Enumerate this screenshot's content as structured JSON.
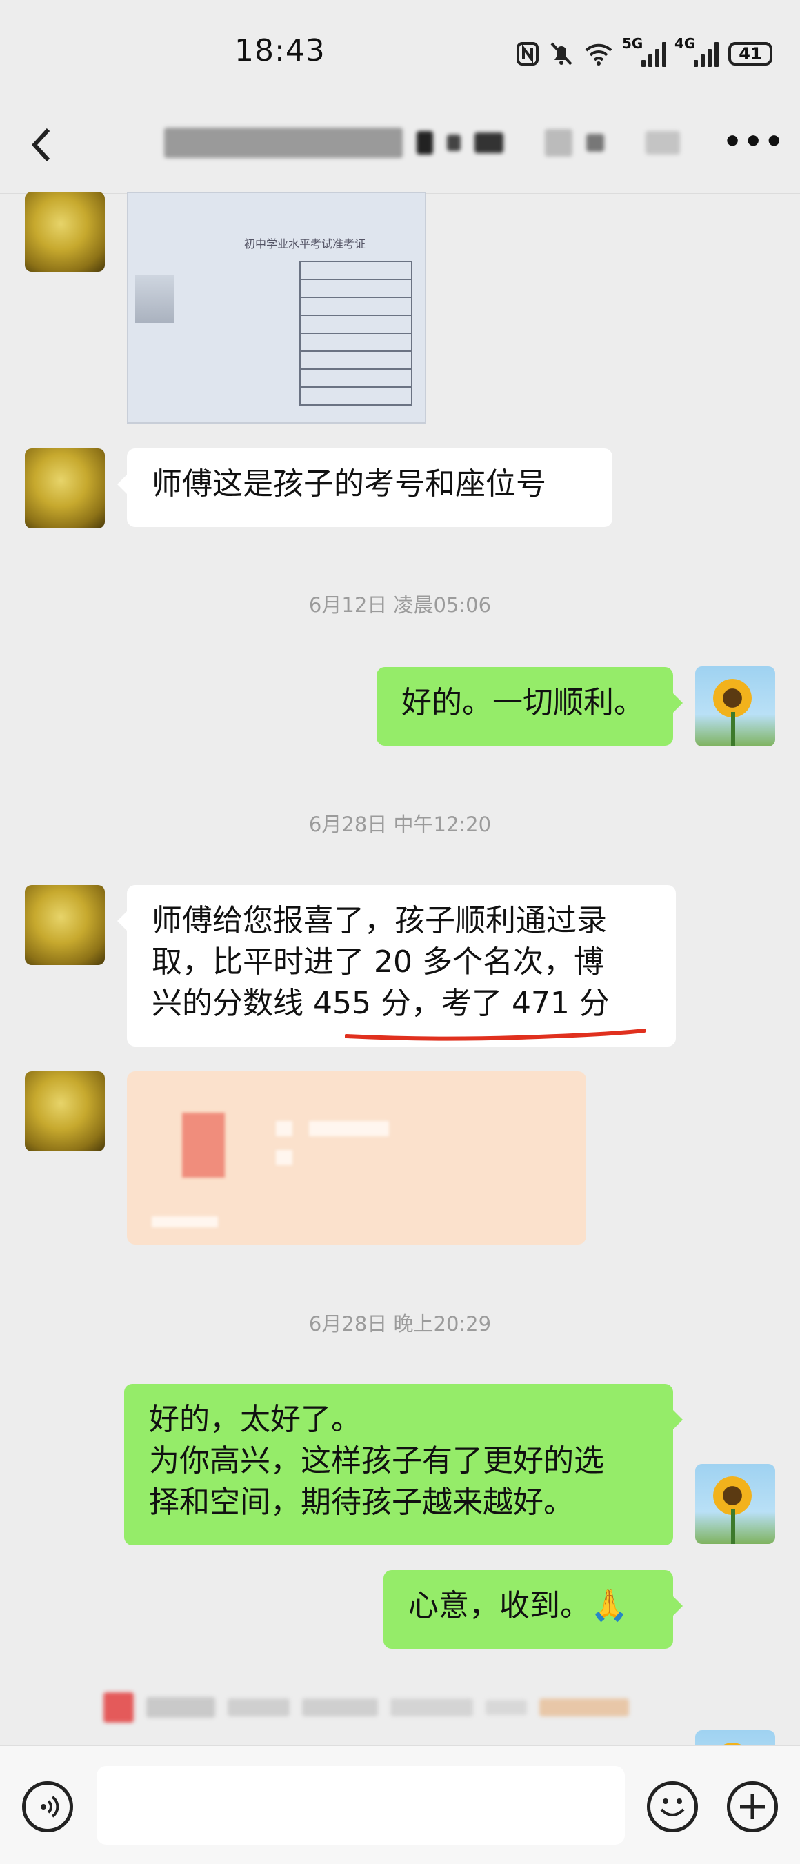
{
  "status_bar": {
    "time": "18:43",
    "network_5g": "5G",
    "network_4g": "4G",
    "battery": "41",
    "icons": [
      "nfc-icon",
      "mute-bell-icon",
      "wifi-icon",
      "signal-5g-icon",
      "signal-4g-icon",
      "battery-icon"
    ]
  },
  "nav": {
    "back_icon": "chevron-left-icon",
    "title": "",
    "more_icon": "more-dots-icon"
  },
  "messages": [
    {
      "type": "image",
      "sender": "other",
      "header_text": "初中学业水平考试准考证"
    },
    {
      "type": "text",
      "sender": "other",
      "text": "师傅这是孩子的考号和座位号"
    },
    {
      "type": "time",
      "text": "6月12日 凌晨05:06"
    },
    {
      "type": "text",
      "sender": "me",
      "text": "好的。一切顺利。"
    },
    {
      "type": "time",
      "text": "6月28日 中午12:20"
    },
    {
      "type": "text",
      "sender": "other",
      "lines": [
        "师傅给您报喜了，孩子顺利通过录",
        "取，比平时进了 20 多个名次，博",
        "兴的分数线 455 分，考了 471 分"
      ]
    },
    {
      "type": "red_packet",
      "sender": "other"
    },
    {
      "type": "time",
      "text": "6月28日 晚上20:29"
    },
    {
      "type": "text",
      "sender": "me",
      "lines": [
        "好的，太好了。",
        "为你高兴，这样孩子有了更好的选",
        "择和空间，期待孩子越来越好。"
      ]
    },
    {
      "type": "text",
      "sender": "me",
      "text": "心意，收到。🙏"
    }
  ],
  "input_bar": {
    "voice_icon": "voice-icon",
    "emoji_icon": "emoji-icon",
    "plus_icon": "plus-icon"
  },
  "colors": {
    "background": "#ededed",
    "my_bubble": "#95ec69",
    "their_bubble": "#ffffff",
    "red_packet": "#fbe1cc",
    "underline": "#e0301e"
  }
}
